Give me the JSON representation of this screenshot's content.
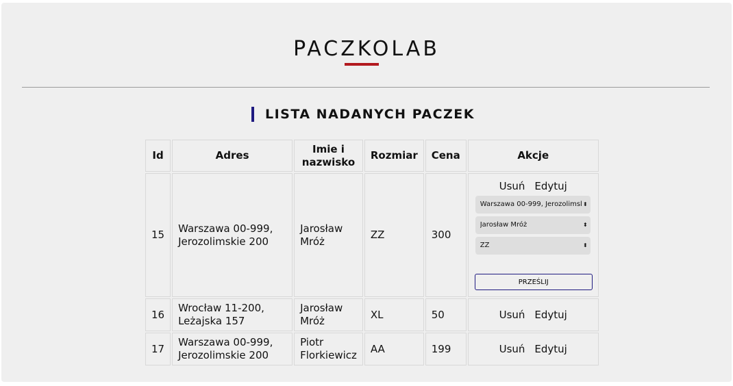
{
  "header": {
    "logo": "PACZKOLAB",
    "section_title": "LISTA NADANYCH PACZEK"
  },
  "colors": {
    "accent_red": "#b3191f",
    "accent_navy": "#1f1a80",
    "panel_bg": "#efefef"
  },
  "table": {
    "columns": [
      "Id",
      "Adres",
      "Imie i nazwisko",
      "Rozmiar",
      "Cena",
      "Akcje"
    ],
    "actions": {
      "delete": "Usuń",
      "edit": "Edytuj"
    },
    "rows": [
      {
        "id": "15",
        "adres": "Warszawa 00-999, Jerozolimskie 200",
        "name": "Jarosław Mróż",
        "size": "ZZ",
        "price": "300"
      },
      {
        "id": "16",
        "adres": "Wrocław 11-200, Leżajska 157",
        "name": "Jarosław Mróż",
        "size": "XL",
        "price": "50"
      },
      {
        "id": "17",
        "adres": "Warszawa 00-999, Jerozolimskie 200",
        "name": "Piotr Florkiewicz",
        "size": "AA",
        "price": "199"
      }
    ]
  },
  "edit_form": {
    "address_select": "Warszawa 00-999, Jerozolimsl",
    "name_select": "Jarosław Mróż",
    "size_select": "ZZ",
    "submit_label": "PRZEŚLIJ"
  }
}
